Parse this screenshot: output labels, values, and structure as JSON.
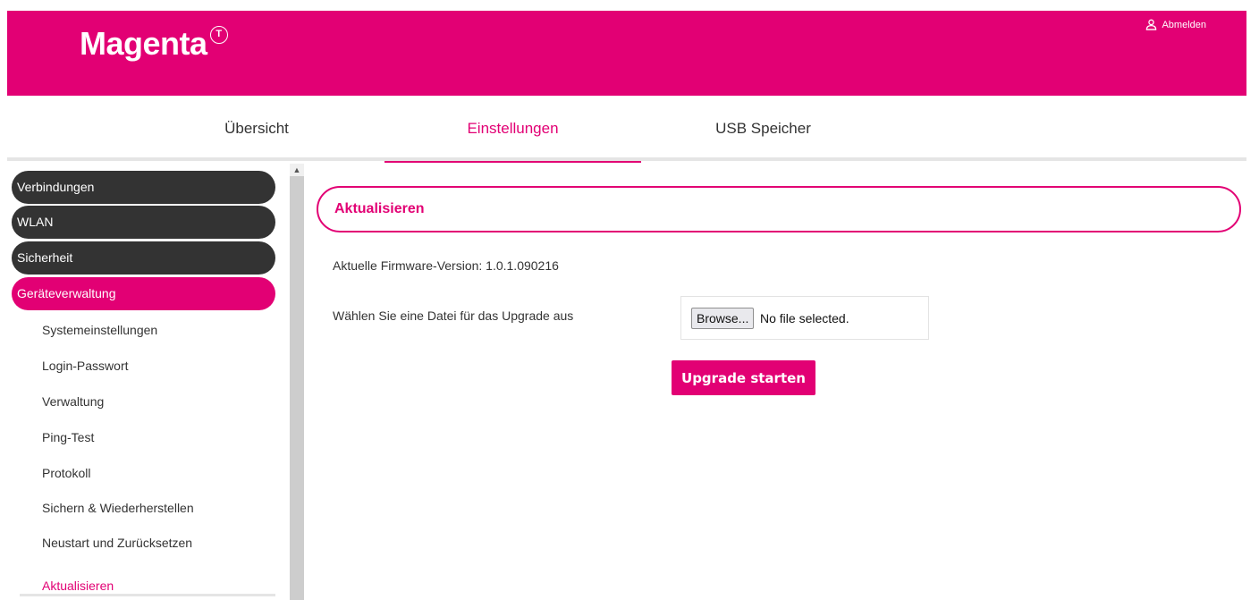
{
  "header": {
    "logo_text": "Magenta",
    "logo_mark": "T",
    "logout_label": "Abmelden",
    "logout_icon": "user-icon",
    "brand_color": "#e20074"
  },
  "nav": {
    "tabs": [
      {
        "label": "Übersicht",
        "active": false
      },
      {
        "label": "Einstellungen",
        "active": true
      },
      {
        "label": "USB Speicher",
        "active": false
      }
    ]
  },
  "sidebar": {
    "groups": [
      {
        "label": "Verbindungen"
      },
      {
        "label": "WLAN"
      },
      {
        "label": "Sicherheit"
      },
      {
        "label": "Geräteverwaltung",
        "active": true
      }
    ],
    "subitems": [
      {
        "label": "Systemeinstellungen"
      },
      {
        "label": "Login-Passwort"
      },
      {
        "label": "Verwaltung"
      },
      {
        "label": "Ping-Test"
      },
      {
        "label": "Protokoll"
      },
      {
        "label": "Sichern & Wiederherstellen"
      },
      {
        "label": "Neustart und Zurücksetzen"
      },
      {
        "label": "Aktualisieren",
        "active": true
      }
    ]
  },
  "content": {
    "title": "Aktualisieren",
    "firmware_text": "Aktuelle Firmware-Version: 1.0.1.090216",
    "choose_label": "Wählen Sie eine Datei für das Upgrade aus",
    "browse_label": "Browse...",
    "no_file_text": "No file selected.",
    "upgrade_label": "Upgrade starten"
  }
}
